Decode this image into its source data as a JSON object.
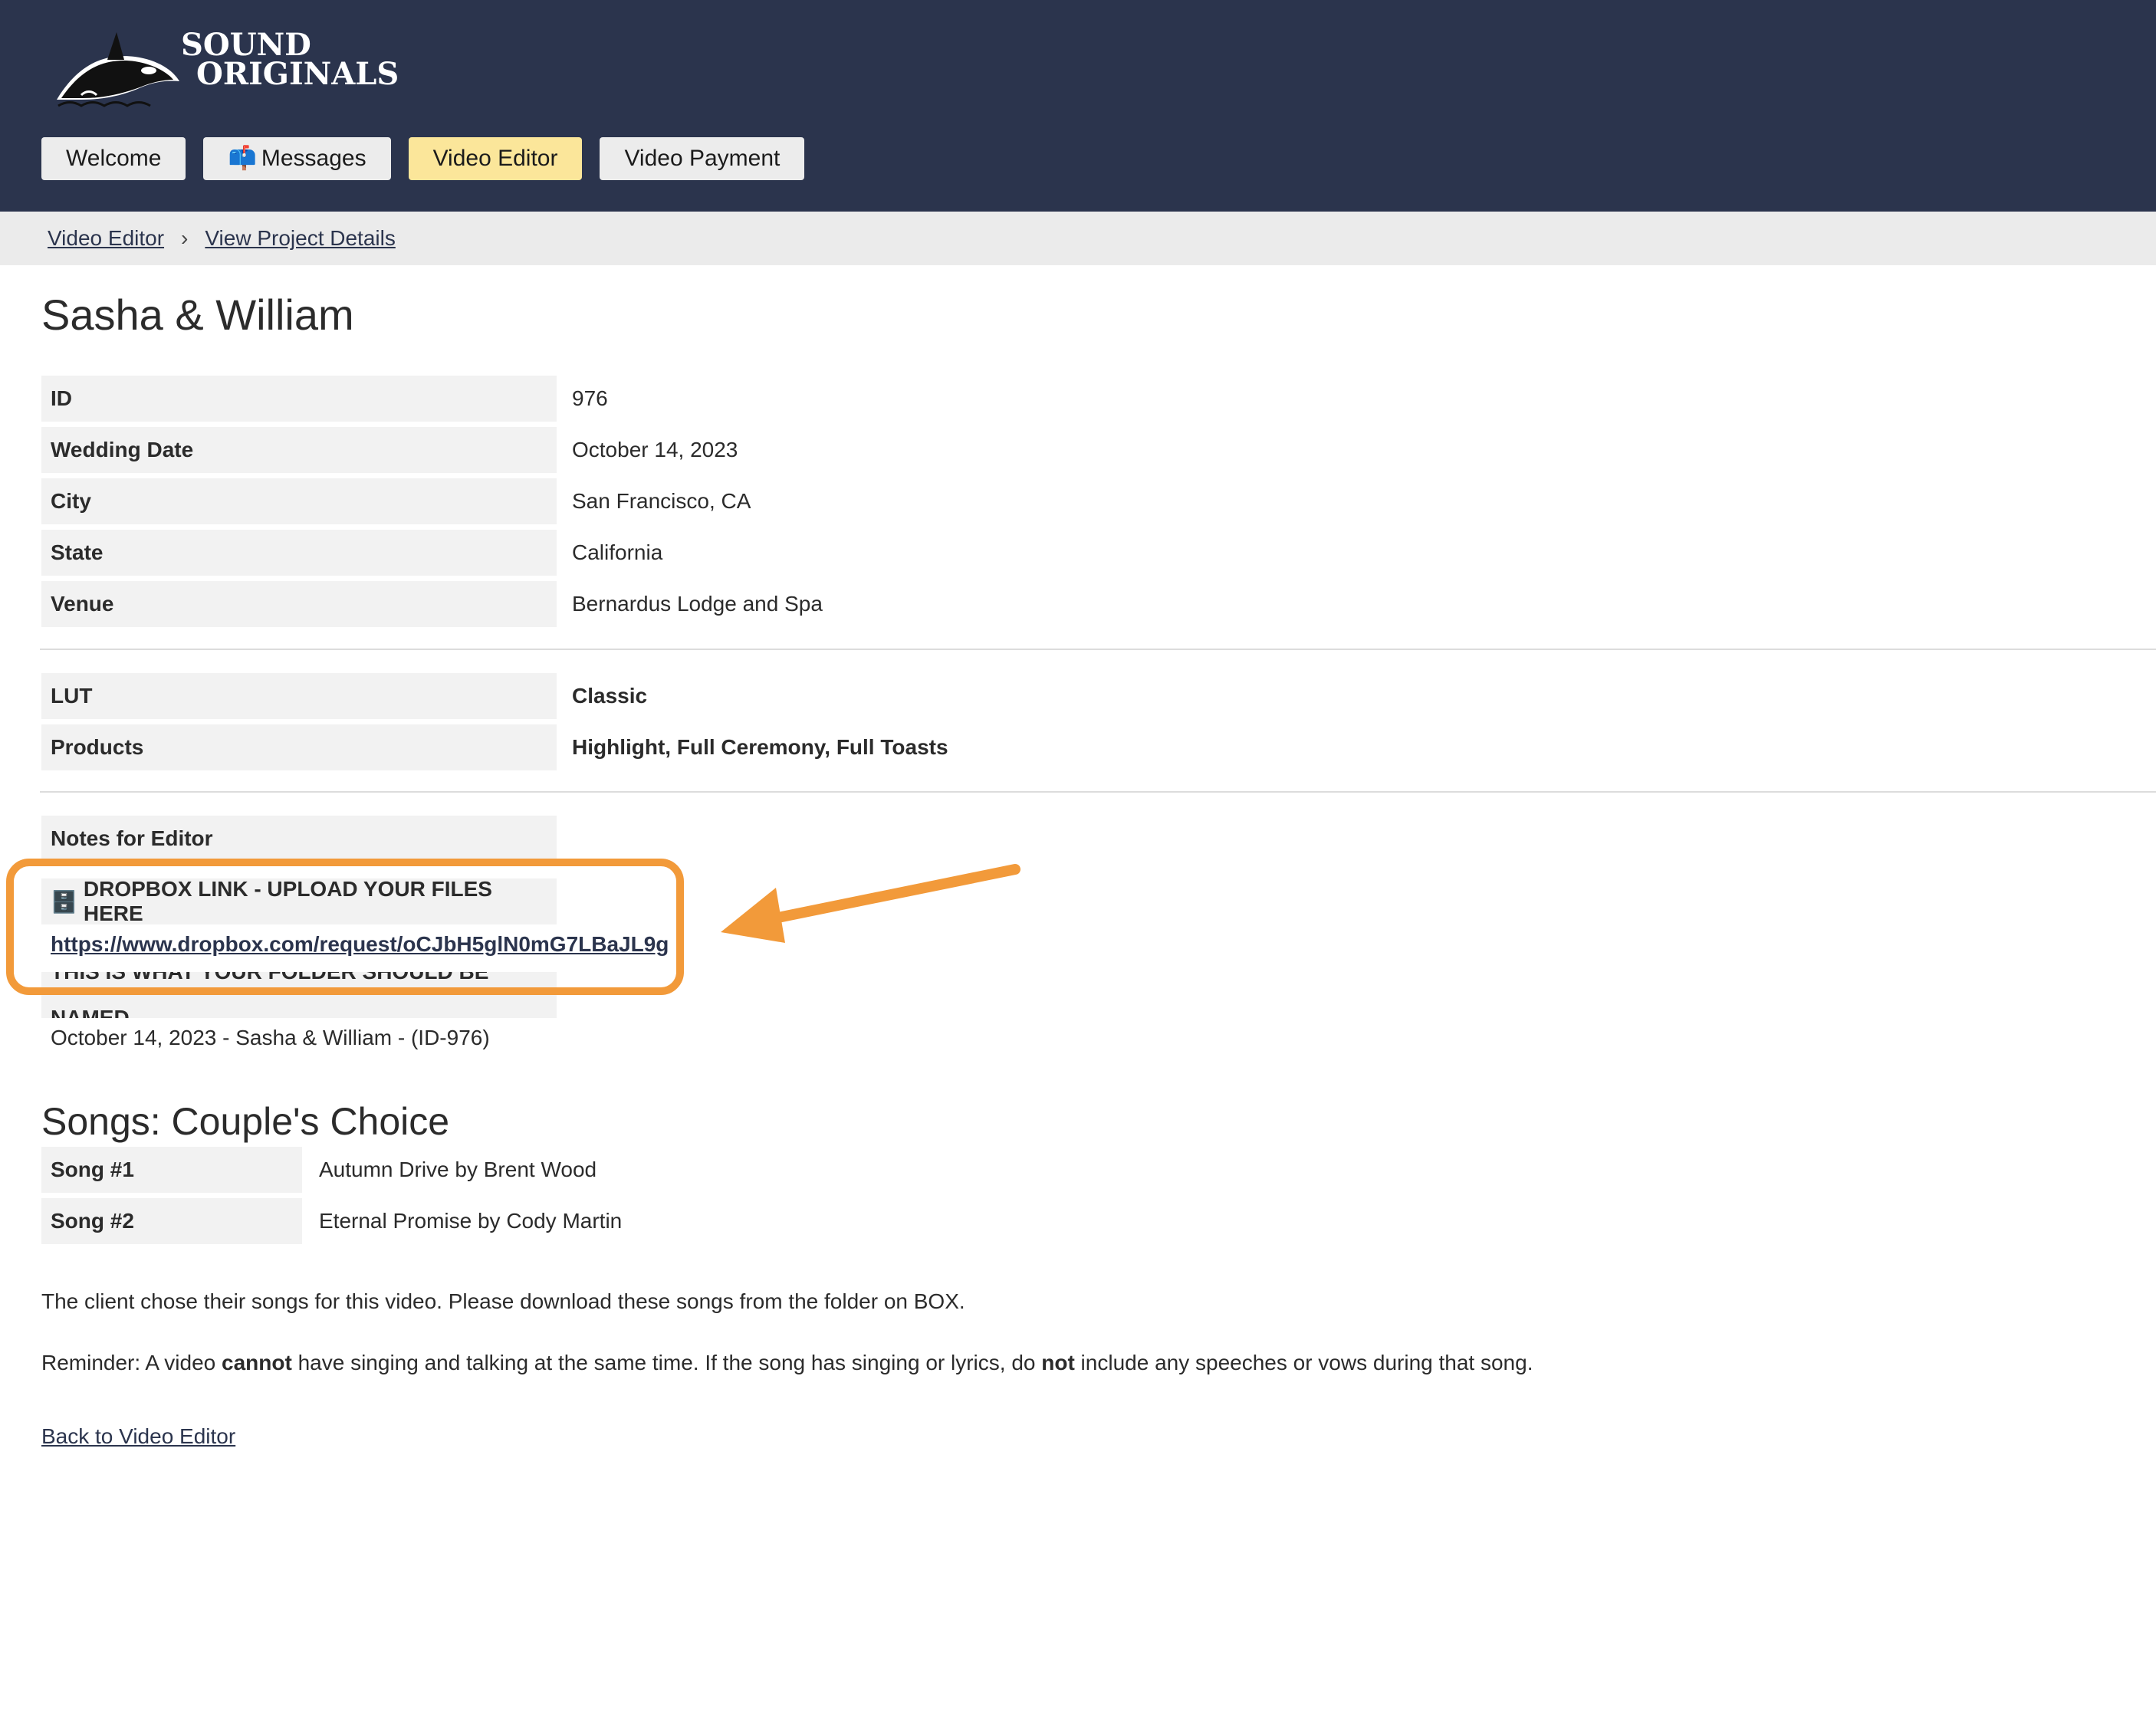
{
  "brand": {
    "line1": "SOUND",
    "line2": "ORIGINALS"
  },
  "nav": [
    {
      "label": "Welcome",
      "icon": ""
    },
    {
      "label": "Messages",
      "icon": "📫"
    },
    {
      "label": "Video Editor",
      "icon": ""
    },
    {
      "label": "Video Payment",
      "icon": ""
    }
  ],
  "breadcrumb": {
    "item1": "Video Editor",
    "separator": "›",
    "item2": "View Project Details"
  },
  "title": "Sasha & William",
  "details": [
    {
      "label": "ID",
      "value": "976"
    },
    {
      "label": "Wedding Date",
      "value": "October 14, 2023"
    },
    {
      "label": "City",
      "value": "San Francisco, CA"
    },
    {
      "label": "State",
      "value": "California"
    },
    {
      "label": "Venue",
      "value": "Bernardus Lodge and Spa"
    }
  ],
  "specs": [
    {
      "label": "LUT",
      "value": "Classic"
    },
    {
      "label": "Products",
      "value": "Highlight, Full Ceremony, Full Toasts"
    }
  ],
  "notes": {
    "label": "Notes for Editor",
    "dropbox_icon": "🗄️",
    "dropbox_label": "DROPBOX LINK - UPLOAD YOUR FILES HERE",
    "dropbox_url": "https://www.dropbox.com/request/oCJbH5glN0mG7LBaJL9g",
    "folder_label": "THIS IS WHAT YOUR FOLDER SHOULD BE NAMED",
    "folder_value": "October 14, 2023 - Sasha & William - (ID-976)"
  },
  "songs": {
    "heading": "Songs: Couple's Choice",
    "items": [
      {
        "label": "Song #1",
        "value": "Autumn Drive by Brent Wood"
      },
      {
        "label": "Song #2",
        "value": "Eternal Promise by Cody Martin"
      }
    ]
  },
  "info_text": "The client chose their songs for this video. Please download these songs from the folder on BOX.",
  "reminder": {
    "p1": "Reminder: A video ",
    "b1": "cannot",
    "p2": " have singing and talking at the same time. If the song has singing or lyrics, do ",
    "b2": "not",
    "p3": " include any speeches or vows during that song."
  },
  "back_link": "Back to Video Editor",
  "colors": {
    "header_bg": "#2b344d",
    "active_tab": "#fbe69a",
    "highlight": "#f29a3a",
    "label_bg": "#f2f2f2"
  }
}
